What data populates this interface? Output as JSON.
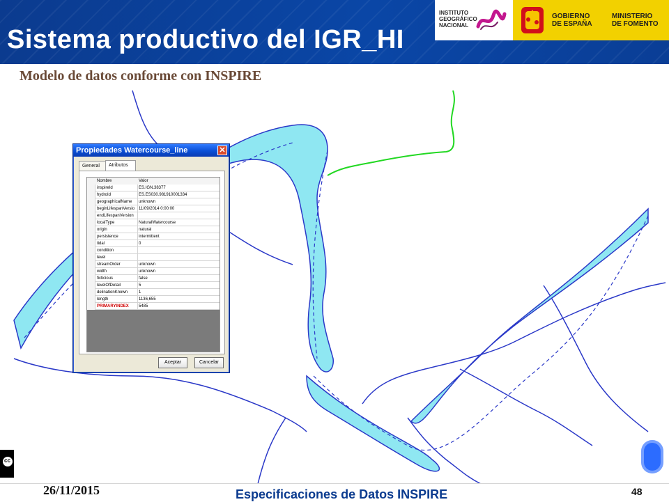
{
  "header": {
    "title": "Sistema productivo del IGR_HI",
    "logos": {
      "ign_lines": [
        "INSTITUTO",
        "GEOGRÁFICO",
        "NACIONAL"
      ],
      "gob_lines_1": [
        "GOBIERNO",
        "DE ESPAÑA"
      ],
      "gob_lines_2": [
        "MINISTERIO",
        "DE FOMENTO"
      ]
    }
  },
  "subtitle": "Modelo de datos conforme con INSPIRE",
  "dialog": {
    "title": "Propiedades Watercourse_line",
    "tabs": [
      "General",
      "Atributos"
    ],
    "columns": [
      "Nombre",
      "Valor"
    ],
    "rows": [
      {
        "name": "inspireId",
        "value": "ES.IGN.38377"
      },
      {
        "name": "hydroId",
        "value": "ES.ES030.981910001334"
      },
      {
        "name": "geographicalName",
        "value": "unknown"
      },
      {
        "name": "beginLifespanVersio",
        "value": "11/09/2014 0:00:00"
      },
      {
        "name": "endLifespanVersion",
        "value": ""
      },
      {
        "name": "localType",
        "value": "NaturalWatercourse"
      },
      {
        "name": "origin",
        "value": "natural"
      },
      {
        "name": "persistence",
        "value": "intermittent"
      },
      {
        "name": "tidal",
        "value": "0"
      },
      {
        "name": "condition",
        "value": ""
      },
      {
        "name": "level",
        "value": ""
      },
      {
        "name": "streamOrder",
        "value": "unknown"
      },
      {
        "name": "width",
        "value": "unknown"
      },
      {
        "name": "ficticious",
        "value": "false"
      },
      {
        "name": "levelOfDetail",
        "value": "5"
      },
      {
        "name": "delinationKnown",
        "value": "1"
      },
      {
        "name": "length",
        "value": "1136,655"
      },
      {
        "name": "PRIMARYINDEX",
        "value": "5485"
      }
    ],
    "buttons": {
      "accept": "Aceptar",
      "cancel": "Cancelar"
    },
    "close_symbol": "✕"
  },
  "footer": {
    "date": "26/11/2015",
    "text": "Especificaciones de Datos INSPIRE",
    "page": "48"
  },
  "colors": {
    "header_blue": "#0a46a6",
    "river_fill": "#8fe7f2",
    "river_stroke": "#2b39c8",
    "green_line": "#22d822"
  }
}
